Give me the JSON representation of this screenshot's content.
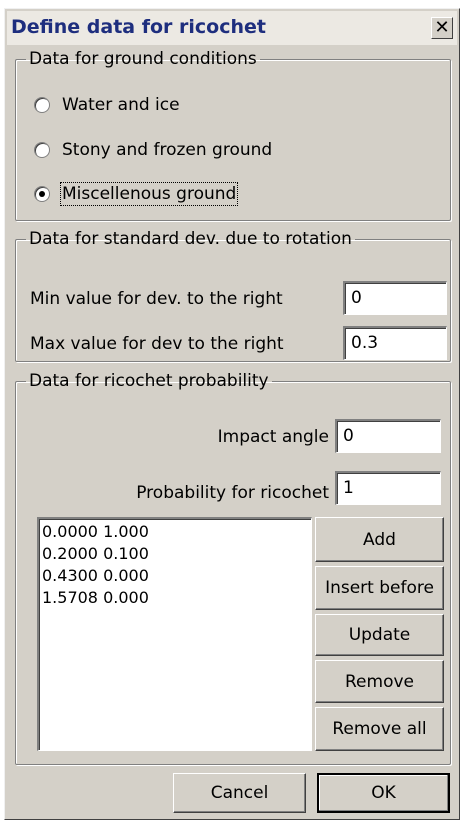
{
  "window": {
    "title": "Define data for ricochet",
    "close_glyph": "✕"
  },
  "ground": {
    "legend": "Data for ground conditions",
    "options": [
      {
        "label": "Water and ice",
        "selected": false
      },
      {
        "label": "Stony and frozen ground",
        "selected": false
      },
      {
        "label": "Miscellenous ground",
        "selected": true
      }
    ]
  },
  "rotation": {
    "legend": "Data for standard dev. due to rotation",
    "min_label": "Min value for dev. to the right",
    "min_value": "0",
    "max_label": "Max value for dev to the right",
    "max_value": "0.3"
  },
  "probability": {
    "legend": "Data for ricochet probability",
    "impact_label": "Impact angle",
    "impact_value": "0",
    "prob_label": "Probability for ricochet",
    "prob_value": "1",
    "list": [
      "0.0000 1.000",
      "0.2000 0.100",
      "0.4300 0.000",
      "1.5708 0.000"
    ],
    "buttons": {
      "add": "Add",
      "insert_before": "Insert before",
      "update": "Update",
      "remove": "Remove",
      "remove_all": "Remove all"
    }
  },
  "footer": {
    "cancel": "Cancel",
    "ok": "OK"
  }
}
